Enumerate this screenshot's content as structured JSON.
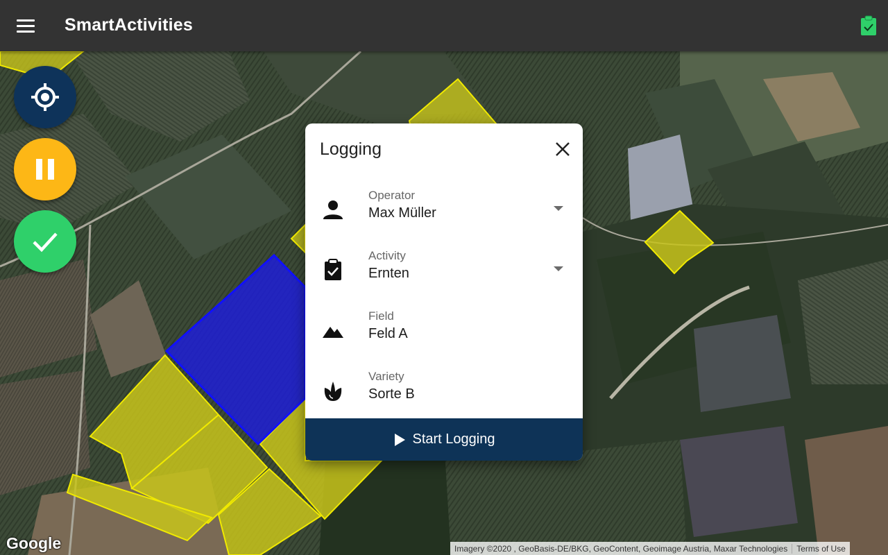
{
  "app": {
    "title": "SmartActivities"
  },
  "header": {
    "menu_icon": "menu-icon",
    "status_icon": "clipboard-check-icon",
    "status_color": "#2fd06a"
  },
  "fabs": [
    {
      "name": "locate",
      "icon": "my-location-icon",
      "color": "#0e335a"
    },
    {
      "name": "pause",
      "icon": "pause-icon",
      "color": "#fdb716"
    },
    {
      "name": "done",
      "icon": "check-icon",
      "color": "#2fd06a"
    }
  ],
  "dialog": {
    "title": "Logging",
    "close_icon": "close-icon",
    "fields": {
      "operator": {
        "label": "Operator",
        "value": "Max Müller",
        "icon": "person-icon"
      },
      "activity": {
        "label": "Activity",
        "value": "Ernten",
        "icon": "clipboard-check-icon"
      },
      "field": {
        "label": "Field",
        "value": "Feld A",
        "icon": "terrain-icon"
      },
      "variety": {
        "label": "Variety",
        "value": "Sorte B",
        "icon": "flower-icon"
      }
    },
    "start_button": {
      "label": "Start Logging",
      "icon": "play-icon",
      "color": "#0e3357"
    }
  },
  "map": {
    "logo": "Google",
    "attribution": "Imagery ©2020 , GeoBasis-DE/BKG, GeoContent, Geoimage Austria, Maxar Technologies",
    "terms": "Terms of Use",
    "field_highlight_color": "#d8d21a",
    "selected_field_color": "#1f1fd6"
  }
}
